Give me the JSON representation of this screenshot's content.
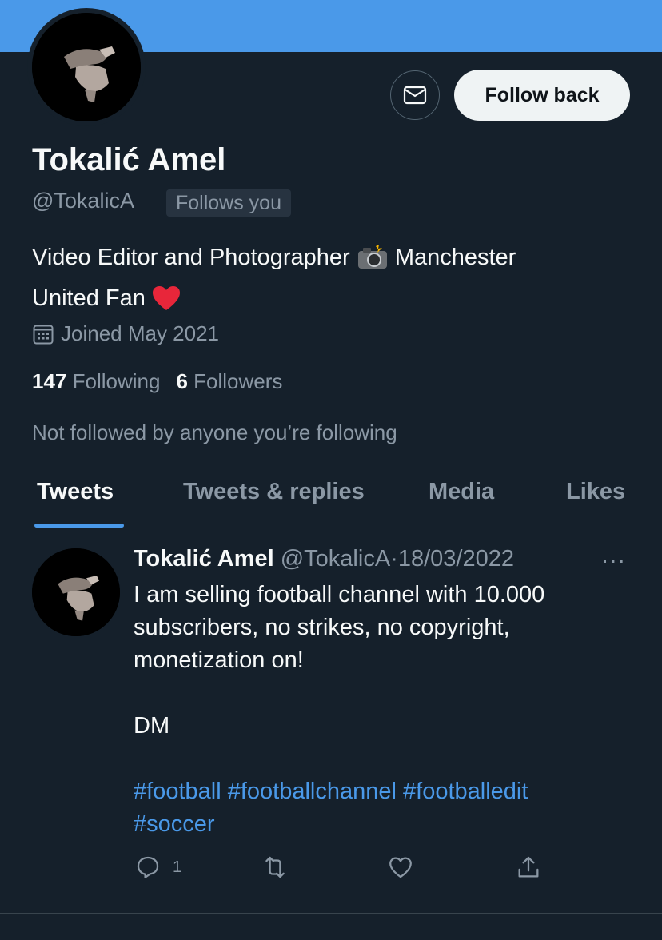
{
  "profile": {
    "name": "Tokalić Amel",
    "handle": "@TokalicA",
    "follows_you": "Follows you",
    "bio_line1": "Video Editor and Photographer",
    "bio_line1b": "Manchester",
    "bio_line2": "United Fan",
    "joined": "Joined May 2021",
    "following_count": "147",
    "following_label": "Following",
    "followers_count": "6",
    "followers_label": "Followers",
    "not_followed": "Not followed by anyone you’re following"
  },
  "actions": {
    "follow_back": "Follow back",
    "message_icon": "envelope-icon"
  },
  "tabs": [
    {
      "label": "Tweets",
      "active": true
    },
    {
      "label": "Tweets & replies",
      "active": false
    },
    {
      "label": "Media",
      "active": false
    },
    {
      "label": "Likes",
      "active": false
    }
  ],
  "tweet": {
    "author": "Tokalić Amel",
    "handle": "@TokalicA",
    "separator": "·",
    "date": "18/03/2022",
    "more": "···",
    "line1": "I am selling football channel with 10.000",
    "line2": "subscribers, no strikes, no copyright,",
    "line3": "monetization on!",
    "dm": "DM",
    "hashtags": [
      "#football",
      "#footballchannel",
      "#footballedit",
      "#soccer"
    ],
    "reply_count": "1"
  },
  "colors": {
    "background": "#15202b",
    "banner": "#4a99e9",
    "accent": "#4a99e9",
    "secondary_text": "#8b98a5",
    "primary_text": "#f7f9f9"
  }
}
